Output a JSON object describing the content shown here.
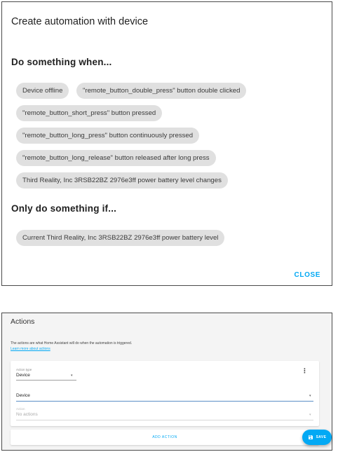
{
  "dialog": {
    "title": "Create automation with device",
    "trigger_section_title": "Do something when...",
    "triggers": [
      "Device offline",
      "\"remote_button_double_press\" button double clicked",
      "\"remote_button_short_press\" button pressed",
      "\"remote_button_long_press\" button continuously pressed",
      "\"remote_button_long_release\" button released after long press",
      "Third Reality, Inc 3RSB22BZ 2976e3ff power battery level changes"
    ],
    "condition_section_title": "Only do something if...",
    "conditions": [
      "Current Third Reality, Inc 3RSB22BZ 2976e3ff power battery level"
    ],
    "close_label": "CLOSE"
  },
  "actions_panel": {
    "title": "Actions",
    "description": "The actions are what Home Assistant will do when the automation is triggered.",
    "learn_more": "Learn more about actions",
    "action_type_label": "Action type",
    "action_type_value": "Device",
    "device_value": "Device",
    "action_label": "Action",
    "action_value": "No actions",
    "add_action_label": "ADD ACTION",
    "save_label": "SAVE"
  },
  "colors": {
    "accent": "#03a9f4",
    "chip_bg": "#e0e0e0"
  }
}
